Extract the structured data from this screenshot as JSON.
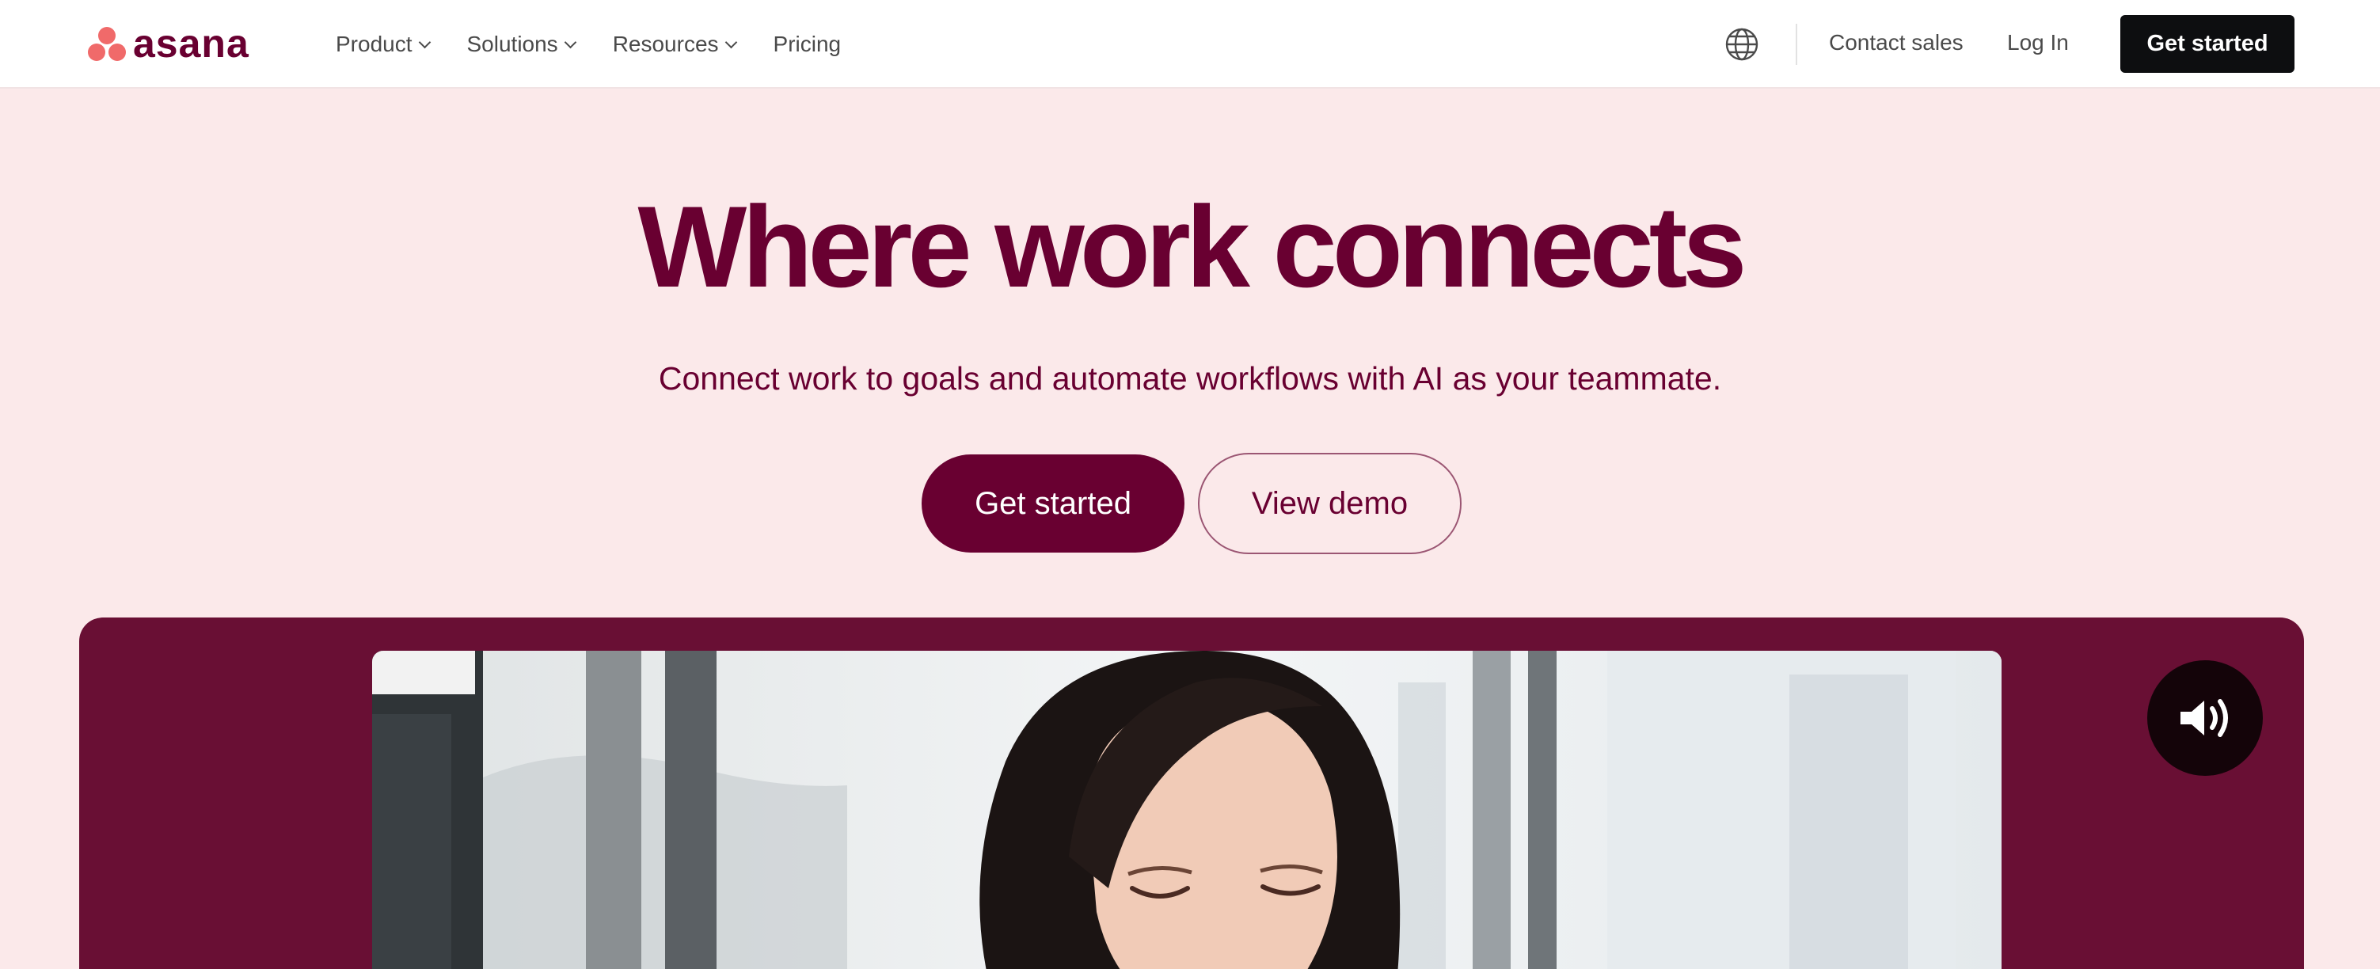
{
  "brand": {
    "wordmark": "asana",
    "accent": "#f06a6a",
    "primary": "#690031"
  },
  "nav": {
    "items": [
      {
        "label": "Product",
        "has_dropdown": true
      },
      {
        "label": "Solutions",
        "has_dropdown": true
      },
      {
        "label": "Resources",
        "has_dropdown": true
      },
      {
        "label": "Pricing",
        "has_dropdown": false
      }
    ],
    "globe_icon": "globe-icon",
    "contact_label": "Contact sales",
    "login_label": "Log In",
    "cta_label": "Get started"
  },
  "hero": {
    "title": "Where work connects",
    "subtitle": "Connect work to goals and automate workflows with AI as your teammate.",
    "primary_cta": "Get started",
    "secondary_cta": "View demo"
  },
  "media": {
    "panel_color": "#690f34",
    "sound_icon": "speaker-volume-icon"
  }
}
